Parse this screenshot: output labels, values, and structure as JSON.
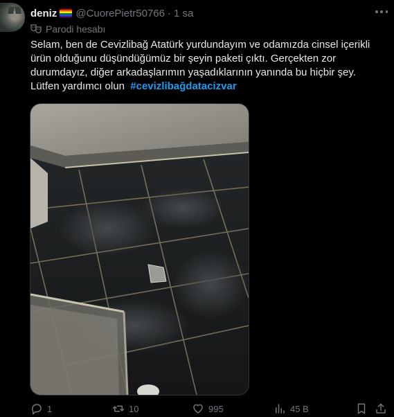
{
  "tweet": {
    "display_name": "deniz",
    "handle": "@CuorePietr50766",
    "separator": "·",
    "time": "1 sa",
    "parody_label": "Parodi hesabı",
    "text_lines": [
      "Selam, ben de Cevizlibağ Atatürk yurdundayım ve odamızda cinsel içerikli",
      "ürün olduğunu düşündüğümüz bir şeyin paketi çıktı. Gerçekten zor",
      "durumdayız, diğer arkadaşlarımın yaşadıklarının yanında bu hiçbir şey."
    ],
    "last_line_text": "Lütfen yardımcı olun",
    "hashtag": "#cevizlibağdatacizvar"
  },
  "actions": {
    "replies": "1",
    "reposts": "10",
    "likes": "995",
    "views": "45 B"
  },
  "icons": {
    "more": "more-horizontal-icon",
    "parody": "theater-masks-icon",
    "reply": "reply-icon",
    "repost": "repost-icon",
    "like": "heart-icon",
    "views": "views-chart-icon",
    "bookmark": "bookmark-icon",
    "share": "share-icon"
  },
  "colors": {
    "background": "#000000",
    "text": "#e7e9ea",
    "muted": "#71767b",
    "link": "#1d9bf0"
  }
}
